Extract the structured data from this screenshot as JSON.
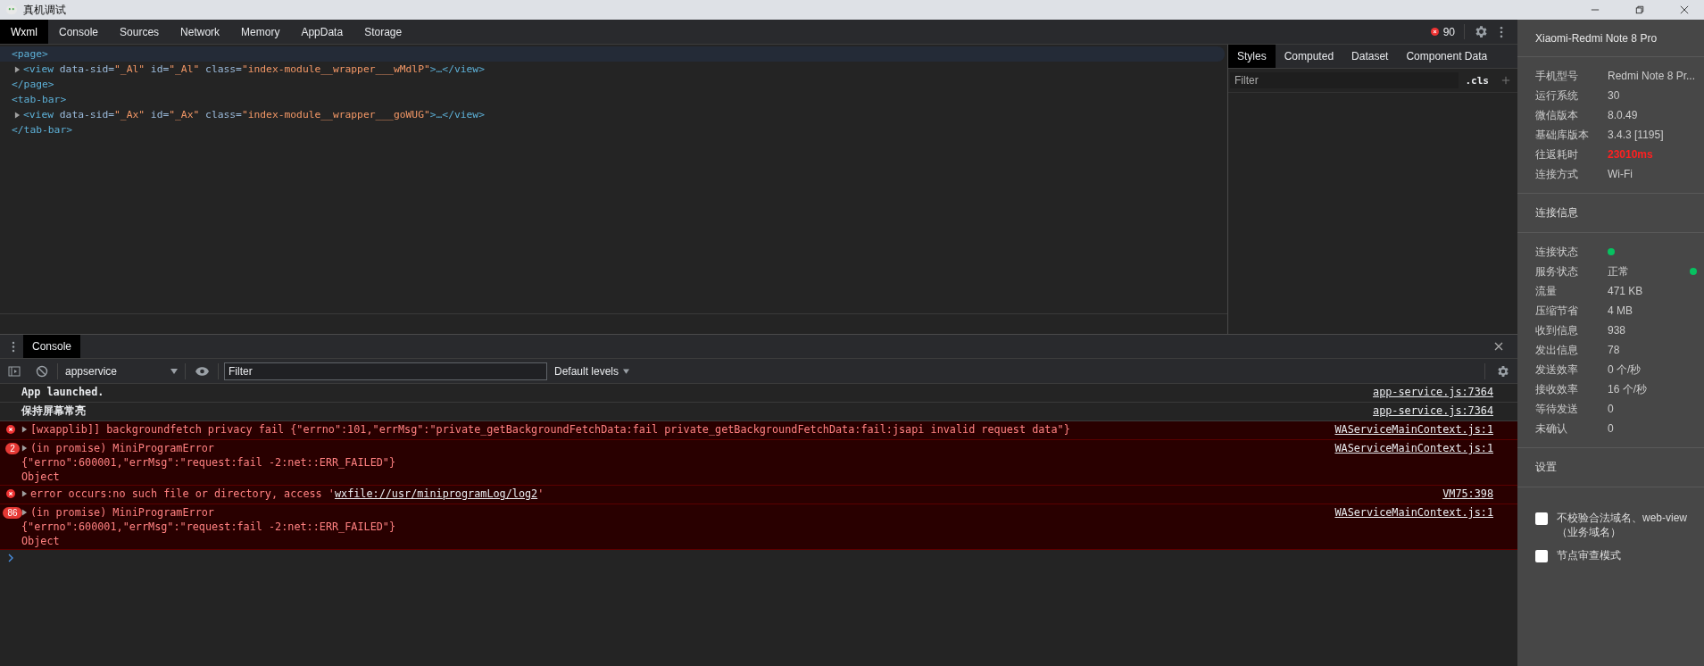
{
  "window": {
    "title": "真机调试"
  },
  "devtools": {
    "tabs": [
      {
        "label": "Wxml",
        "selected": true
      },
      {
        "label": "Console",
        "selected": false
      },
      {
        "label": "Sources",
        "selected": false
      },
      {
        "label": "Network",
        "selected": false
      },
      {
        "label": "Memory",
        "selected": false
      },
      {
        "label": "AppData",
        "selected": false
      },
      {
        "label": "Storage",
        "selected": false
      }
    ],
    "error_count": "90"
  },
  "wxml": {
    "nodes": [
      {
        "open": "<page>",
        "close": "</page>",
        "selected": true,
        "children": [
          {
            "expanded": false,
            "selected": false,
            "segments": [
              {
                "kind": "tag",
                "text": "<view"
              },
              {
                "kind": "attr",
                "text": " data-sid="
              },
              {
                "kind": "value",
                "text": "\"_Al\""
              },
              {
                "kind": "attr",
                "text": " id="
              },
              {
                "kind": "value",
                "text": "\"_Al\""
              },
              {
                "kind": "attr",
                "text": " class="
              },
              {
                "kind": "value",
                "text": "\"index-module__wrapper___wMdlP\""
              },
              {
                "kind": "tag",
                "text": ">…</view>"
              }
            ]
          }
        ]
      },
      {
        "open": "<tab-bar>",
        "close": "</tab-bar>",
        "selected": false,
        "children": [
          {
            "expanded": false,
            "selected": false,
            "segments": [
              {
                "kind": "tag",
                "text": "<view"
              },
              {
                "kind": "attr",
                "text": " data-sid="
              },
              {
                "kind": "value",
                "text": "\"_Ax\""
              },
              {
                "kind": "attr",
                "text": " id="
              },
              {
                "kind": "value",
                "text": "\"_Ax\""
              },
              {
                "kind": "attr",
                "text": " class="
              },
              {
                "kind": "value",
                "text": "\"index-module__wrapper___goWUG\""
              },
              {
                "kind": "tag",
                "text": ">…</view>"
              }
            ]
          }
        ]
      }
    ]
  },
  "styles_pane": {
    "tabs": [
      {
        "label": "Styles",
        "selected": true
      },
      {
        "label": "Computed",
        "selected": false
      },
      {
        "label": "Dataset",
        "selected": false
      },
      {
        "label": "Component Data",
        "selected": false
      }
    ],
    "filter": {
      "placeholder": "Filter"
    },
    "cls_button": ".cls"
  },
  "console": {
    "tabs": [
      {
        "label": "Console",
        "selected": true
      }
    ],
    "context": "appservice",
    "filter": {
      "placeholder": "Filter"
    },
    "levels": "Default levels",
    "messages": [
      {
        "kind": "log",
        "lines": [
          [
            {
              "kind": "text",
              "text": "App launched."
            }
          ]
        ],
        "source": "app-service.js:7364"
      },
      {
        "kind": "log",
        "lines": [
          [
            {
              "kind": "text",
              "text": "保持屏幕常亮"
            }
          ]
        ],
        "source": "app-service.js:7364"
      },
      {
        "kind": "error",
        "expanded": false,
        "lines": [
          [
            {
              "kind": "text",
              "text": "[wxapplib]] backgroundfetch privacy fail {\"errno\":101,\"errMsg\":\"private_getBackgroundFetchData:fail private_getBackgroundFetchData:fail:jsapi invalid request data\"}"
            }
          ]
        ],
        "source": "WAServiceMainContext.js:1"
      },
      {
        "kind": "error",
        "count": "2",
        "expanded": false,
        "lines": [
          [
            {
              "kind": "text",
              "text": "(in promise) MiniProgramError"
            }
          ],
          [
            {
              "kind": "text",
              "text": "{\"errno\":600001,\"errMsg\":\"request:fail -2:net::ERR_FAILED\"}"
            }
          ],
          [
            {
              "kind": "text",
              "text": "Object"
            }
          ]
        ],
        "source": "WAServiceMainContext.js:1"
      },
      {
        "kind": "error",
        "expanded": false,
        "lines": [
          [
            {
              "kind": "text",
              "text": "error occurs:no such file or directory, access '"
            },
            {
              "kind": "link",
              "text": "wxfile://usr/miniprogramLog/log2"
            },
            {
              "kind": "text",
              "text": "'"
            }
          ]
        ],
        "source": "VM75:398"
      },
      {
        "kind": "error",
        "count": "86",
        "expanded": false,
        "lines": [
          [
            {
              "kind": "text",
              "text": "(in promise) MiniProgramError"
            }
          ],
          [
            {
              "kind": "text",
              "text": "{\"errno\":600001,\"errMsg\":\"request:fail -2:net::ERR_FAILED\"}"
            }
          ],
          [
            {
              "kind": "text",
              "text": "Object"
            }
          ]
        ],
        "source": "WAServiceMainContext.js:1"
      }
    ]
  },
  "device_panel": {
    "device": "Xiaomi-Redmi Note 8 Pro",
    "info": [
      {
        "label": "手机型号",
        "value": "Redmi Note 8 Pr...",
        "alert": false
      },
      {
        "label": "运行系统",
        "value": "30",
        "alert": false
      },
      {
        "label": "微信版本",
        "value": "8.0.49",
        "alert": false
      },
      {
        "label": "基础库版本",
        "value": "3.4.3 [1195]",
        "alert": false
      },
      {
        "label": "往返耗时",
        "value": "23010ms",
        "alert": true
      },
      {
        "label": "连接方式",
        "value": "Wi-Fi",
        "alert": false
      }
    ],
    "connection_title": "连接信息",
    "connection": [
      {
        "kind": "status",
        "label": "连接状态",
        "color": "#07c160"
      },
      {
        "kind": "status",
        "label": "服务状态",
        "value": "正常",
        "color": "#07c160"
      },
      {
        "kind": "text",
        "label": "流量",
        "value": "471 KB"
      },
      {
        "kind": "text",
        "label": "压缩节省",
        "value": "4 MB"
      },
      {
        "kind": "text",
        "label": "收到信息",
        "value": "938"
      },
      {
        "kind": "text",
        "label": "发出信息",
        "value": "78"
      },
      {
        "kind": "text",
        "label": "发送效率",
        "value": "0 个/秒"
      },
      {
        "kind": "text",
        "label": "接收效率",
        "value": "16 个/秒"
      },
      {
        "kind": "text",
        "label": "等待发送",
        "value": "0"
      },
      {
        "kind": "text",
        "label": "未确认",
        "value": "0"
      }
    ],
    "settings_title": "设置",
    "settings": [
      {
        "label": "不校验合法域名、web-view（业务域名）",
        "checked": false
      },
      {
        "label": "节点审查模式",
        "checked": false
      }
    ]
  }
}
